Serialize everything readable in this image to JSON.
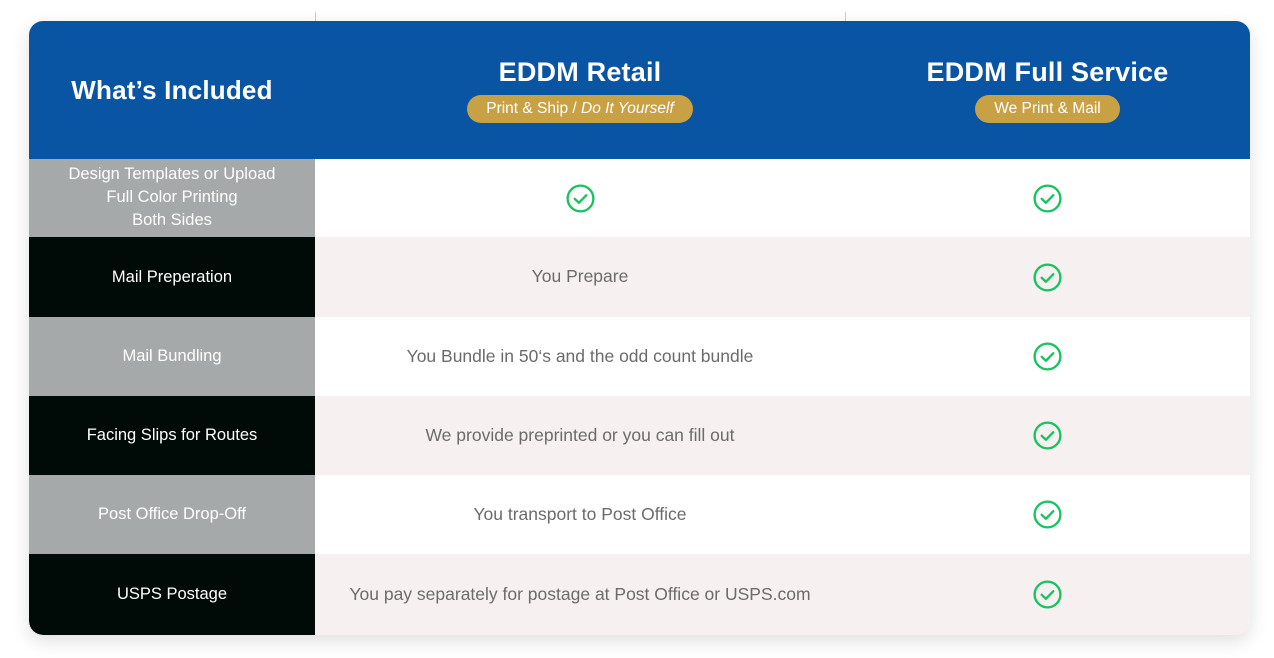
{
  "header": {
    "included_title": "What’s Included",
    "columns": [
      {
        "title": "EDDM Retail",
        "badge_main": "Print & Ship / ",
        "badge_italic": "Do It Yourself"
      },
      {
        "title": "EDDM Full Service",
        "badge_main": "We Print & Mail",
        "badge_italic": ""
      }
    ]
  },
  "colors": {
    "header_blue": "#0a54a4",
    "badge_gold": "#c9a145",
    "check_green": "#16c45f",
    "row_dark": "#000a06",
    "row_light": "#a5a9a9",
    "cell_tint": "#f7f0f0"
  },
  "rows": [
    {
      "label": "Design Templates or Upload\nFull Color Printing\nBoth Sides",
      "label_line1": "Design Templates or Upload",
      "label_line2": "Full Color Printing",
      "label_line3": "Both Sides",
      "retail": "",
      "retail_icon": "check-circle-icon",
      "full_service": "",
      "full_service_icon": "check-circle-icon"
    },
    {
      "label": "Mail Preperation",
      "retail": "You Prepare",
      "retail_icon": "",
      "full_service": "",
      "full_service_icon": "check-circle-icon"
    },
    {
      "label": "Mail Bundling",
      "retail": "You Bundle in 50‘s and the odd count bundle",
      "retail_icon": "",
      "full_service": "",
      "full_service_icon": "check-circle-icon"
    },
    {
      "label": "Facing Slips for Routes",
      "retail": "We provide preprinted or you can fill out",
      "retail_icon": "",
      "full_service": "",
      "full_service_icon": "check-circle-icon"
    },
    {
      "label": "Post Office Drop-Off",
      "retail": "You transport to Post Office",
      "retail_icon": "",
      "full_service": "",
      "full_service_icon": "check-circle-icon"
    },
    {
      "label": "USPS Postage",
      "retail": "You pay separately for postage at Post Office or USPS.com",
      "retail_icon": "",
      "full_service": "",
      "full_service_icon": "check-circle-icon"
    }
  ]
}
